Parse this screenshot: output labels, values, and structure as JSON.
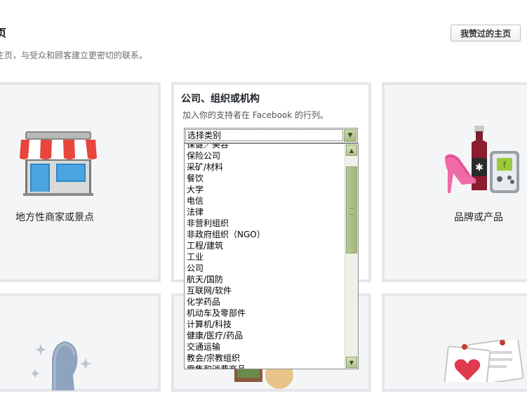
{
  "header": {
    "title": "页",
    "subtitle": "主页，与受众和顾客建立更密切的联系。",
    "liked_pages_button": "我赞过的主页"
  },
  "categories": {
    "local_business": "地方性商家或景点",
    "company": {
      "title": "公司、组织或机构",
      "description": "加入你的支持者在 Facebook 的行列。",
      "select_value": "选择类别",
      "options": [
        "保健／美容",
        "保险公司",
        "采矿/材料",
        "餐饮",
        "大学",
        "电信",
        "法律",
        "非营利组织",
        "非政府组织（NGO）",
        "工程/建筑",
        "工业",
        "公司",
        "航天/国防",
        "互联网/软件",
        "化学药品",
        "机动车及零部件",
        "计算机/科技",
        "健康/医疗/药品",
        "交通运输",
        "教会/宗教组织",
        "零售和消费商品"
      ]
    },
    "brand": "品牌或产品"
  },
  "colors": {
    "tile_bg": "#f4f5f7",
    "tile_border": "#e4e6ea",
    "scroll_green": "#a9ba84"
  }
}
